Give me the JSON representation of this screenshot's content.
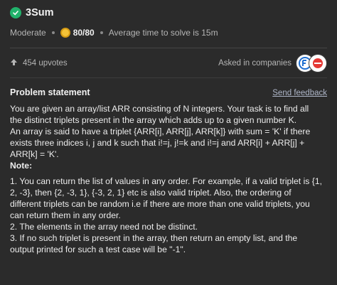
{
  "problem": {
    "title": "3Sum",
    "difficulty": "Moderate",
    "score": "80/80",
    "avg_time": "Average time to solve is 15m"
  },
  "stats": {
    "upvotes": "454 upvotes",
    "asked_in": "Asked in companies"
  },
  "statement": {
    "header": "Problem statement",
    "feedback": "Send feedback",
    "lines": [
      "You are given an array/list ARR consisting of N integers. Your task is to find all",
      "the distinct triplets present in the array which adds up to a given number K.",
      "An array is said to have a triplet {ARR[i], ARR[j], ARR[k]} with sum = 'K' if there",
      "exists three indices i, j and k such that i!=j, j!=k and i!=j and ARR[i] + ARR[j] +",
      "ARR[k] = 'K'."
    ],
    "note_label": "Note:",
    "note_lines": [
      "1. You can return the list of values in any order. For example, if a valid triplet is {1,",
      "2, -3}, then {2, -3, 1}, {-3, 2, 1} etc is also valid triplet. Also, the ordering of",
      "different triplets can be random i.e if there are more than one valid triplets, you",
      "can return them in any order.",
      "2. The elements in the array need not be distinct.",
      "3. If no such triplet is present in the array, then return an empty list, and the",
      "output printed for such a test case will be \"-1\"."
    ]
  },
  "icons": {
    "solved": "check-icon",
    "coin": "coin-icon",
    "upvote": "arrow-up-icon"
  },
  "colors": {
    "background": "#2b2b2b",
    "solved_green": "#21b26b",
    "coin_gold": "#f3c238"
  }
}
